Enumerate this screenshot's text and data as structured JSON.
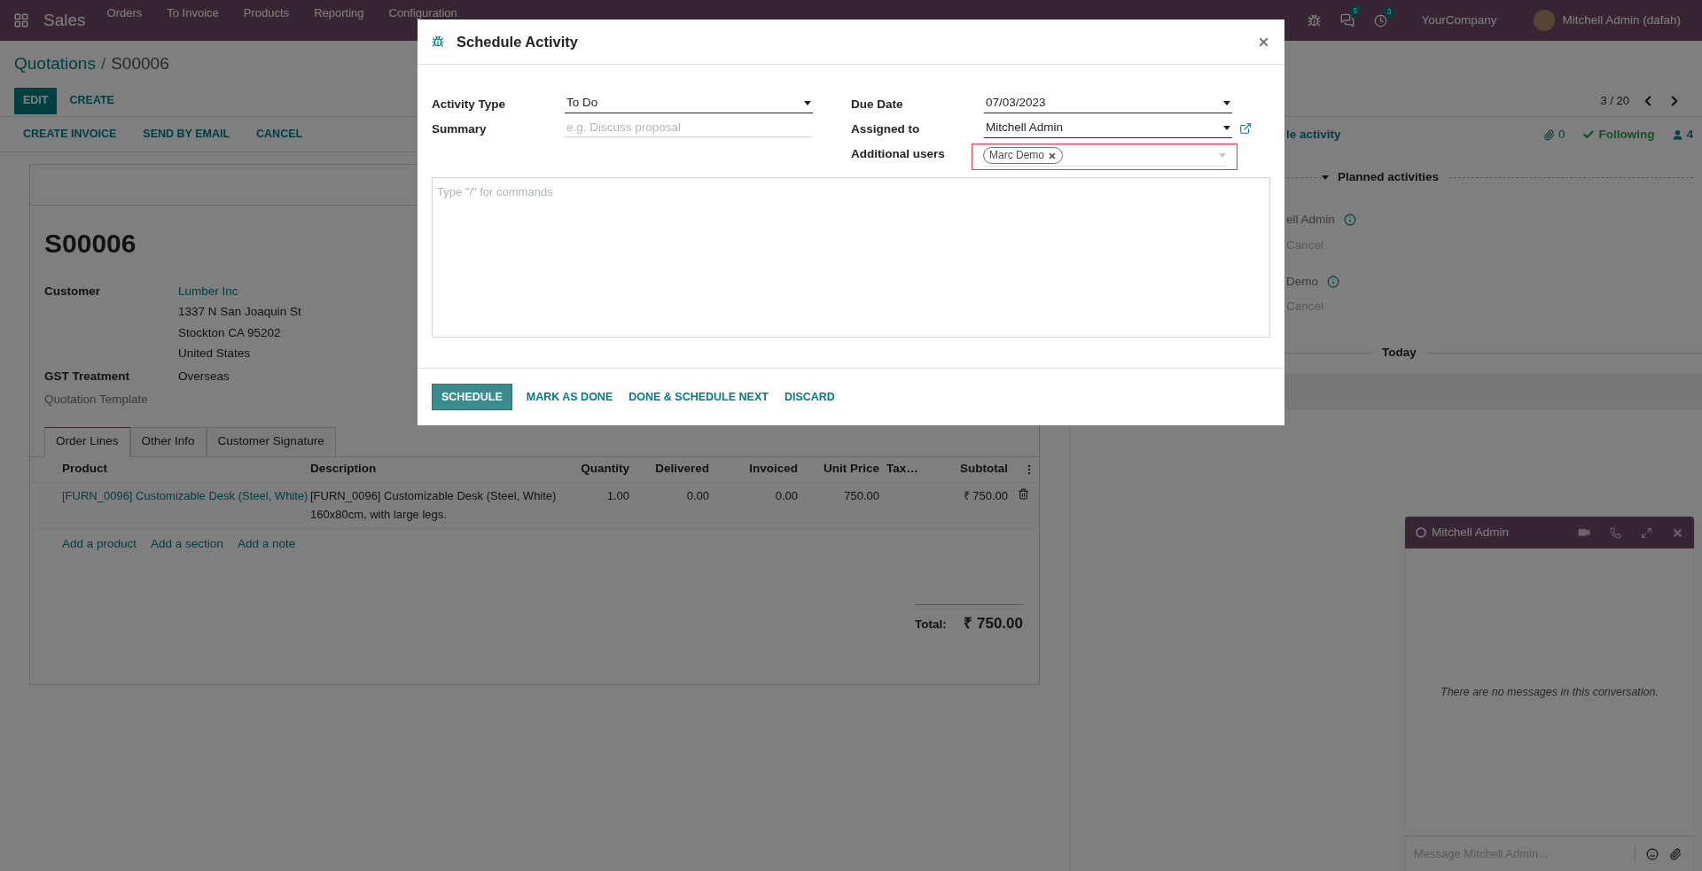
{
  "navbar": {
    "app": "Sales",
    "menu": [
      "Orders",
      "To Invoice",
      "Products",
      "Reporting",
      "Configuration"
    ],
    "messages_count": "5",
    "activities_count": "3",
    "company": "YourCompany",
    "user": "Mitchell Admin (dafah)"
  },
  "breadcrumb": {
    "parent": "Quotations",
    "separator": "/",
    "current": "S00006"
  },
  "actions": [
    {
      "label": "EDIT",
      "kind": "primary"
    },
    {
      "label": "CREATE",
      "kind": "link"
    }
  ],
  "pager": "3 / 20",
  "status_buttons": [
    "CREATE INVOICE",
    "SEND BY EMAIL",
    "CANCEL"
  ],
  "form": {
    "name": "S00006",
    "fields": [
      {
        "label": "Customer",
        "empty": false,
        "link": "Lumber Inc",
        "lines": [
          "1337 N San Joaquin St",
          "Stockton CA 95202",
          "United States"
        ]
      },
      {
        "label": "GST Treatment",
        "empty": false,
        "lines": [
          "Overseas"
        ]
      },
      {
        "label": "Quotation Template",
        "empty": true
      }
    ],
    "tabs": [
      {
        "label": "Order Lines",
        "selected": true
      },
      {
        "label": "Other Info",
        "selected": false
      },
      {
        "label": "Customer Signature",
        "selected": false
      }
    ],
    "columns": [
      "Product",
      "Description",
      "Quantity",
      "Delivered",
      "Invoiced",
      "Unit Price",
      "Tax…",
      "Subtotal"
    ],
    "rows": [
      {
        "product": "[FURN_0096] Customizable Desk (Steel, White)",
        "description": [
          "[FURN_0096] Customizable Desk (Steel, White)",
          "160x80cm, with large legs."
        ],
        "quantity": "1.00",
        "delivered": "0.00",
        "invoiced": "0.00",
        "unit_price": "750.00",
        "subtotal": "₹ 750.00"
      }
    ],
    "add_links": [
      "Add a product",
      "Add a section",
      "Add a note"
    ],
    "total": {
      "label": "Total:",
      "value": "₹ 750.00"
    }
  },
  "chatter": {
    "schedule_fragment": "le activity",
    "attachments": "0",
    "follow": "Following",
    "followers": "4",
    "planned_label": "Planned activities",
    "activities": [
      {
        "name_fragment": "ell Admin",
        "action": "Cancel"
      },
      {
        "name_fragment": "Demo",
        "action": "Cancel"
      }
    ],
    "today": "Today"
  },
  "dialog": {
    "title": "Schedule Activity",
    "left_fields": [
      {
        "label": "Activity Type",
        "kind": "select",
        "value": "To Do"
      },
      {
        "label": "Summary",
        "kind": "text",
        "placeholder": "e.g. Discuss proposal"
      }
    ],
    "right_fields": [
      {
        "label": "Due Date",
        "kind": "select",
        "value": "07/03/2023"
      },
      {
        "label": "Assigned to",
        "kind": "select_link",
        "value": "Mitchell Admin"
      },
      {
        "label": "Additional users",
        "kind": "tags",
        "tags": [
          "Marc Demo"
        ],
        "highlighted": true
      }
    ],
    "note_placeholder": "Type \"/\" for commands",
    "buttons": [
      {
        "label": "SCHEDULE",
        "kind": "primary"
      },
      {
        "label": "MARK AS DONE",
        "kind": "link"
      },
      {
        "label": "DONE & SCHEDULE NEXT",
        "kind": "link"
      },
      {
        "label": "DISCARD",
        "kind": "link"
      }
    ]
  },
  "chat": {
    "title": "Mitchell Admin",
    "empty_text": "There are no messages in this conversation.",
    "placeholder": "Message Mitchell Admin..."
  }
}
